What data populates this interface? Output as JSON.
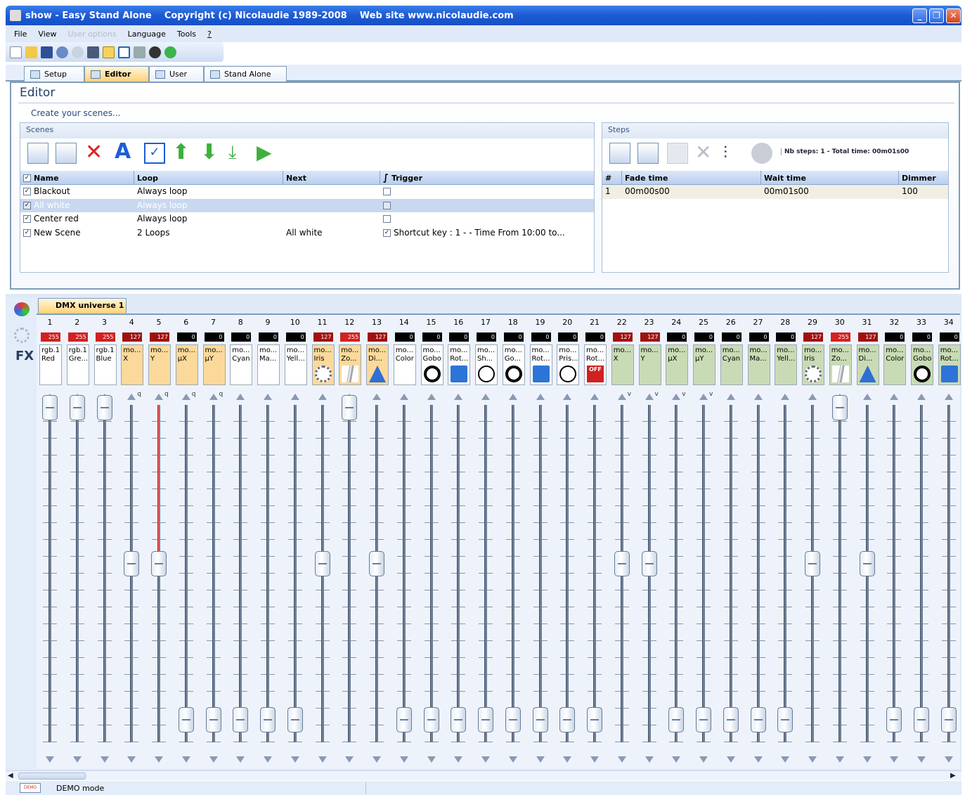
{
  "window": {
    "title": "show - Easy Stand Alone    Copyright (c) Nicolaudie 1989-2008    Web site www.nicolaudie.com"
  },
  "menu": {
    "items": [
      {
        "label": "File",
        "enabled": true
      },
      {
        "label": "View",
        "enabled": true
      },
      {
        "label": "User options",
        "enabled": false
      },
      {
        "label": "Language",
        "enabled": true
      },
      {
        "label": "Tools",
        "enabled": true
      },
      {
        "label": "?",
        "enabled": true
      }
    ]
  },
  "toolbar": {
    "icons": [
      "new-icon",
      "open-icon",
      "save-icon",
      "undo-icon",
      "redo-icon",
      "dmx-icon",
      "val255-icon",
      "window-icon",
      "tools-icon",
      "settings-icon",
      "help-icon"
    ]
  },
  "tabs": [
    {
      "label": "Setup",
      "active": false
    },
    {
      "label": "Editor",
      "active": true
    },
    {
      "label": "User",
      "active": false
    },
    {
      "label": "Stand Alone",
      "active": false
    }
  ],
  "editor": {
    "title": "Editor",
    "subtitle": "Create your scenes...",
    "scenes": {
      "label": "Scenes",
      "columns": [
        "Name",
        "Loop",
        "Next",
        "Trigger"
      ],
      "rows": [
        {
          "name": "Blackout",
          "loop": "Always loop",
          "next": "",
          "trigger_checked": false,
          "trigger": "",
          "selected": false
        },
        {
          "name": "All white",
          "loop": "Always loop",
          "next": "",
          "trigger_checked": false,
          "trigger": "",
          "selected": true
        },
        {
          "name": "Center red",
          "loop": "Always loop",
          "next": "",
          "trigger_checked": false,
          "trigger": "",
          "selected": false
        },
        {
          "name": "New Scene",
          "loop": "2 Loops",
          "next": "All white",
          "trigger_checked": true,
          "trigger": "Shortcut key : 1 - - Time From 10:00  to...",
          "selected": false
        }
      ]
    },
    "steps": {
      "label": "Steps",
      "info": "Nb steps: 1 - Total time: 00m01s00",
      "columns": [
        "#",
        "Fade time",
        "Wait time",
        "Dimmer"
      ],
      "rows": [
        {
          "n": "1",
          "fade": "00m00s00",
          "wait": "00m01s00",
          "dimmer": "100"
        }
      ]
    }
  },
  "dmx": {
    "tab_label": "DMX universe 1",
    "channels": [
      {
        "n": "1",
        "value": "255",
        "name": "rgb.1\nRed",
        "level": 1.0,
        "color": "#d32020",
        "mark": ""
      },
      {
        "n": "2",
        "value": "255",
        "name": "rgb.1\nGre...",
        "level": 1.0,
        "color": "#d32020",
        "mark": ""
      },
      {
        "n": "3",
        "value": "255",
        "name": "rgb.1\nBlue",
        "level": 1.0,
        "color": "#d32020",
        "mark": ""
      },
      {
        "n": "4",
        "value": "127",
        "name": "mo...\nX",
        "level": 0.5,
        "color": "#a01010",
        "mark": "q",
        "bg": "#fbd99a"
      },
      {
        "n": "5",
        "value": "127",
        "name": "mo...\nY",
        "level": 0.5,
        "color": "#a01010",
        "mark": "q",
        "bg": "#fbd99a"
      },
      {
        "n": "6",
        "value": "0",
        "name": "mo...\nµX",
        "level": 0.0,
        "color": "#000000",
        "mark": "q",
        "bg": "#fbd99a"
      },
      {
        "n": "7",
        "value": "0",
        "name": "mo...\nµY",
        "level": 0.0,
        "color": "#000000",
        "mark": "q",
        "bg": "#fbd99a"
      },
      {
        "n": "8",
        "value": "0",
        "name": "mo...\nCyan",
        "level": 0.0,
        "color": "#000000",
        "mark": ""
      },
      {
        "n": "9",
        "value": "0",
        "name": "mo...\nMa...",
        "level": 0.0,
        "color": "#000000",
        "mark": ""
      },
      {
        "n": "10",
        "value": "0",
        "name": "mo...\nYell...",
        "level": 0.0,
        "color": "#000000",
        "mark": ""
      },
      {
        "n": "11",
        "value": "127",
        "name": "mo...\nIris",
        "level": 0.5,
        "color": "#a01010",
        "mark": "",
        "bg": "#fbd99a",
        "sym": "iris"
      },
      {
        "n": "12",
        "value": "255",
        "name": "mo...\nZo...",
        "level": 1.0,
        "color": "#d32020",
        "mark": "",
        "bg": "#fbd99a",
        "sym": "zoom"
      },
      {
        "n": "13",
        "value": "127",
        "name": "mo...\nDi...",
        "level": 0.5,
        "color": "#a01010",
        "mark": "",
        "bg": "#fbd99a",
        "sym": "beam"
      },
      {
        "n": "14",
        "value": "0",
        "name": "mo...\nColor",
        "level": 0.0,
        "color": "#000000",
        "mark": ""
      },
      {
        "n": "15",
        "value": "0",
        "name": "mo...\nGobo",
        "level": 0.0,
        "color": "#000000",
        "mark": "",
        "sym": "circle"
      },
      {
        "n": "16",
        "value": "0",
        "name": "mo...\nRot...",
        "level": 0.0,
        "color": "#000000",
        "mark": "",
        "sym": "blue"
      },
      {
        "n": "17",
        "value": "0",
        "name": "mo...\nSh...",
        "level": 0.0,
        "color": "#000000",
        "mark": "",
        "sym": "ring"
      },
      {
        "n": "18",
        "value": "0",
        "name": "mo...\nGo...",
        "level": 0.0,
        "color": "#000000",
        "mark": "",
        "sym": "circle"
      },
      {
        "n": "19",
        "value": "0",
        "name": "mo...\nRot...",
        "level": 0.0,
        "color": "#000000",
        "mark": "",
        "sym": "blue"
      },
      {
        "n": "20",
        "value": "0",
        "name": "mo...\nPris...",
        "level": 0.0,
        "color": "#000000",
        "mark": "",
        "sym": "ring"
      },
      {
        "n": "21",
        "value": "0",
        "name": "mo...\nRot...",
        "level": 0.0,
        "color": "#000000",
        "mark": "",
        "sym": "off"
      },
      {
        "n": "22",
        "value": "127",
        "name": "mo...\nX",
        "level": 0.5,
        "color": "#a01010",
        "mark": "v",
        "bg": "#c9dbb4"
      },
      {
        "n": "23",
        "value": "127",
        "name": "mo...\nY",
        "level": 0.5,
        "color": "#a01010",
        "mark": "v",
        "bg": "#c9dbb4"
      },
      {
        "n": "24",
        "value": "0",
        "name": "mo...\nµX",
        "level": 0.0,
        "color": "#000000",
        "mark": "v",
        "bg": "#c9dbb4"
      },
      {
        "n": "25",
        "value": "0",
        "name": "mo...\nµY",
        "level": 0.0,
        "color": "#000000",
        "mark": "v",
        "bg": "#c9dbb4"
      },
      {
        "n": "26",
        "value": "0",
        "name": "mo...\nCyan",
        "level": 0.0,
        "color": "#000000",
        "mark": "",
        "bg": "#c9dbb4"
      },
      {
        "n": "27",
        "value": "0",
        "name": "mo...\nMa...",
        "level": 0.0,
        "color": "#000000",
        "mark": "",
        "bg": "#c9dbb4"
      },
      {
        "n": "28",
        "value": "0",
        "name": "mo...\nYell...",
        "level": 0.0,
        "color": "#000000",
        "mark": "",
        "bg": "#c9dbb4"
      },
      {
        "n": "29",
        "value": "127",
        "name": "mo...\nIris",
        "level": 0.5,
        "color": "#a01010",
        "mark": "",
        "bg": "#c9dbb4",
        "sym": "iris"
      },
      {
        "n": "30",
        "value": "255",
        "name": "mo...\nZo...",
        "level": 1.0,
        "color": "#d32020",
        "mark": "",
        "bg": "#c9dbb4",
        "sym": "zoom"
      },
      {
        "n": "31",
        "value": "127",
        "name": "mo...\nDi...",
        "level": 0.5,
        "color": "#a01010",
        "mark": "",
        "bg": "#c9dbb4",
        "sym": "beam"
      },
      {
        "n": "32",
        "value": "0",
        "name": "mo...\nColor",
        "level": 0.0,
        "color": "#000000",
        "mark": "",
        "bg": "#c9dbb4"
      },
      {
        "n": "33",
        "value": "0",
        "name": "mo...\nGobo",
        "level": 0.0,
        "color": "#000000",
        "mark": "",
        "sym": "circle",
        "bg": "#c9dbb4"
      },
      {
        "n": "34",
        "value": "0",
        "name": "mo...\nRot...",
        "level": 0.0,
        "color": "#000000",
        "mark": "",
        "sym": "blue",
        "bg": "#c9dbb4"
      }
    ]
  },
  "statusbar": {
    "text": "DEMO mode",
    "icon_label": "DEMO"
  }
}
